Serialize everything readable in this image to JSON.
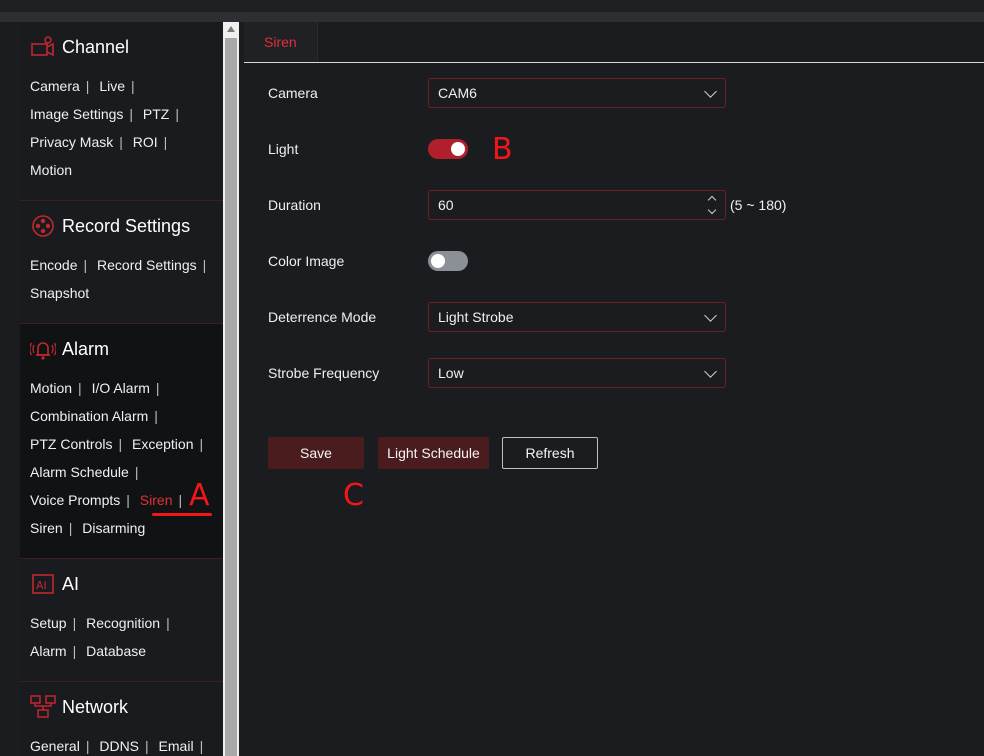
{
  "sidebar": {
    "channel": {
      "title": "Channel",
      "icon": "camera-settings-icon",
      "links": [
        "Camera",
        "Live",
        "Image Settings",
        "PTZ",
        "Privacy Mask",
        "ROI",
        "Motion"
      ]
    },
    "record": {
      "title": "Record Settings",
      "icon": "film-reel-icon",
      "links": [
        "Encode",
        "Record Settings",
        "Snapshot"
      ]
    },
    "alarm": {
      "title": "Alarm",
      "icon": "alarm-bell-icon",
      "links": [
        "Motion",
        "I/O Alarm",
        "Combination Alarm",
        "PTZ Controls",
        "Exception",
        "Alarm Schedule",
        "Voice Prompts",
        "Siren",
        "Siren",
        "Disarming"
      ]
    },
    "ai": {
      "title": "AI",
      "icon": "ai-icon",
      "links": [
        "Setup",
        "Recognition",
        "Alarm",
        "Database"
      ]
    },
    "network": {
      "title": "Network",
      "icon": "network-icon",
      "links": [
        "General",
        "DDNS",
        "Email"
      ]
    }
  },
  "main": {
    "tab": "Siren",
    "camera": {
      "label": "Camera",
      "value": "CAM6"
    },
    "light": {
      "label": "Light",
      "on": true
    },
    "duration": {
      "label": "Duration",
      "value": "60",
      "range": "(5 ~ 180)"
    },
    "color_image": {
      "label": "Color Image",
      "on": false
    },
    "deterrence": {
      "label": "Deterrence Mode",
      "value": "Light Strobe"
    },
    "strobe": {
      "label": "Strobe Frequency",
      "value": "Low"
    },
    "buttons": {
      "save": "Save",
      "light_schedule": "Light Schedule",
      "refresh": "Refresh"
    }
  },
  "annotations": {
    "a": "A",
    "b": "B",
    "c": "C"
  },
  "colors": {
    "accent": "#e0303a",
    "annotation": "#f2161a",
    "toggle_on": "#b0202c"
  }
}
